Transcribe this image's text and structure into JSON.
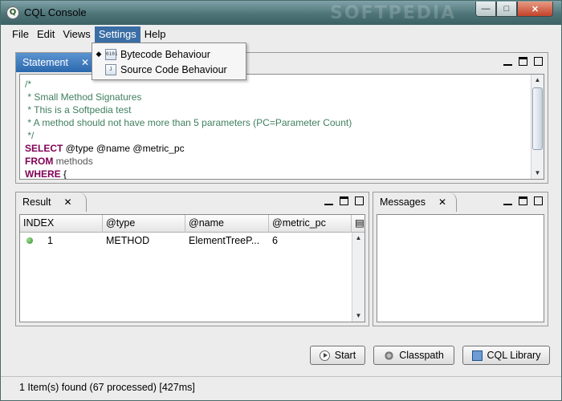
{
  "window": {
    "title": "CQL Console",
    "app_icon": "Q",
    "watermark": "SOFTPEDIA"
  },
  "menu": {
    "items": [
      "File",
      "Edit",
      "Views",
      "Settings",
      "Help"
    ],
    "active": "Settings"
  },
  "settings_menu": {
    "items": [
      {
        "label": "Bytecode Behaviour",
        "checked": true,
        "icon": "bytecode-icon",
        "icon_text": "0101"
      },
      {
        "label": "Source Code Behaviour",
        "checked": false,
        "icon": "source-code-icon",
        "icon_text": "J"
      }
    ]
  },
  "statement_panel": {
    "tab_label": "Statement",
    "code_lines": [
      {
        "kind": "comment",
        "text": "/*"
      },
      {
        "kind": "comment",
        "text": " * Small Method Signatures"
      },
      {
        "kind": "comment",
        "text": " * This is a Softpedia test"
      },
      {
        "kind": "comment",
        "text": " * A method should not have more than 5 parameters (PC=Parameter Count)"
      },
      {
        "kind": "comment",
        "text": " */"
      },
      {
        "kind": "keyword",
        "keyword": "SELECT",
        "rest": " @type @name @metric_pc"
      },
      {
        "kind": "keyword",
        "keyword": "FROM",
        "rest": " methods"
      },
      {
        "kind": "keyword",
        "keyword": "WHERE",
        "rest": " {"
      }
    ]
  },
  "result_panel": {
    "tab_label": "Result",
    "columns": [
      "INDEX",
      "@type",
      "@name",
      "@metric_pc"
    ],
    "rows": [
      {
        "status": "ok",
        "index": "1",
        "type": "METHOD",
        "name": "ElementTreeP...",
        "metric_pc": "6"
      }
    ]
  },
  "messages_panel": {
    "tab_label": "Messages"
  },
  "buttons": {
    "start": "Start",
    "classpath": "Classpath",
    "cql_library": "CQL Library"
  },
  "status": {
    "text": "1 Item(s) found (67 processed) [427ms]"
  },
  "colors": {
    "selected_tab": "#2c68ad",
    "menu_active": "#3a6ea5",
    "comment": "#3f7f5f",
    "keyword": "#7f0055"
  }
}
